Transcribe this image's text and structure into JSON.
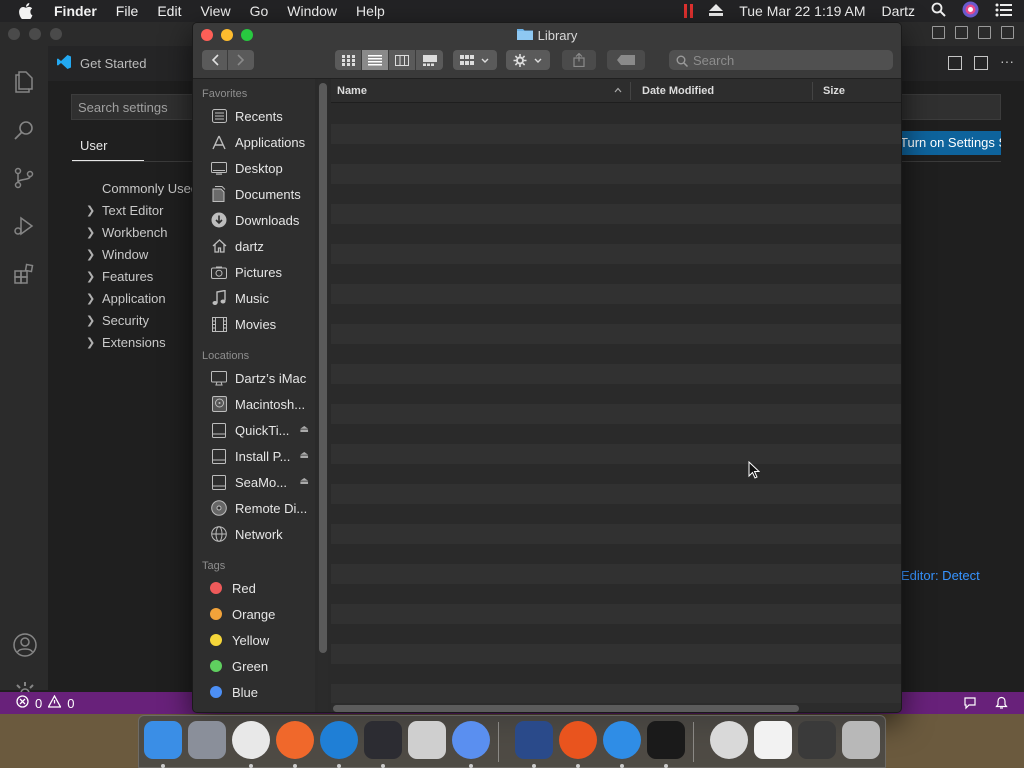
{
  "menubar": {
    "apple_icon": "apple-logo",
    "app_name": "Finder",
    "menus": [
      "File",
      "Edit",
      "View",
      "Go",
      "Window",
      "Help"
    ],
    "clock": "Tue Mar 22  1:19 AM",
    "user": "Dartz"
  },
  "vscode": {
    "tab_title": "Get Started",
    "search_placeholder": "Search settings",
    "user_tab": "User",
    "tree": [
      "Commonly Used",
      "Text Editor",
      "Workbench",
      "Window",
      "Features",
      "Application",
      "Security",
      "Extensions"
    ],
    "sync_button": "Turn on Settings Sync",
    "detect_link": "Editor: Detect",
    "status": {
      "errors": "0",
      "warnings": "0"
    },
    "statusbar_color": "#68217a",
    "accent": "#0e639c"
  },
  "finder": {
    "window_title": "Library",
    "search_placeholder": "Search",
    "view_modes": [
      "icon-view",
      "list-view",
      "column-view",
      "gallery-view"
    ],
    "active_view": "list-view",
    "sidebar": {
      "favorites_label": "Favorites",
      "favorites": [
        {
          "label": "Recents",
          "icon": "recents-icon"
        },
        {
          "label": "Applications",
          "icon": "applications-icon"
        },
        {
          "label": "Desktop",
          "icon": "desktop-icon"
        },
        {
          "label": "Documents",
          "icon": "documents-icon"
        },
        {
          "label": "Downloads",
          "icon": "downloads-icon"
        },
        {
          "label": "dartz",
          "icon": "home-icon"
        },
        {
          "label": "Pictures",
          "icon": "pictures-icon"
        },
        {
          "label": "Music",
          "icon": "music-icon"
        },
        {
          "label": "Movies",
          "icon": "movies-icon"
        }
      ],
      "locations_label": "Locations",
      "locations": [
        {
          "label": "Dartz’s iMac",
          "icon": "imac-icon",
          "eject": false
        },
        {
          "label": "Macintosh...",
          "icon": "hard-disk-icon",
          "eject": false
        },
        {
          "label": "QuickTi...",
          "icon": "disk-image-icon",
          "eject": true
        },
        {
          "label": "Install P...",
          "icon": "disk-image-icon",
          "eject": true
        },
        {
          "label": "SeaMo...",
          "icon": "disk-image-icon",
          "eject": true
        },
        {
          "label": "Remote Di...",
          "icon": "optical-disc-icon",
          "eject": false
        },
        {
          "label": "Network",
          "icon": "network-icon",
          "eject": false
        }
      ],
      "tags_label": "Tags",
      "tags": [
        {
          "label": "Red",
          "color": "#ee5a5a"
        },
        {
          "label": "Orange",
          "color": "#f2a33a"
        },
        {
          "label": "Yellow",
          "color": "#f5d63a"
        },
        {
          "label": "Green",
          "color": "#5fcf5f"
        },
        {
          "label": "Blue",
          "color": "#4c8ff5"
        }
      ]
    },
    "columns": [
      "Name",
      "Date Modified",
      "Size"
    ],
    "sort_column": "Name",
    "row_count": 30
  },
  "dock": {
    "apps": [
      {
        "name": "finder",
        "color": "#3a8ee6",
        "running": true
      },
      {
        "name": "launchpad",
        "color": "#8a8f9a",
        "running": false
      },
      {
        "name": "chrome",
        "color": "#e8e8e8",
        "running": true
      },
      {
        "name": "firefox",
        "color": "#f0682b",
        "running": true
      },
      {
        "name": "edge",
        "color": "#1f7fd6",
        "running": true
      },
      {
        "name": "vscode",
        "color": "#2c2c32",
        "running": true
      },
      {
        "name": "disk-utility-pro",
        "color": "#cfcfcf",
        "running": false
      },
      {
        "name": "chromium",
        "color": "#5a8ff0",
        "running": true
      },
      {
        "name": "system-info",
        "color": "#2a4a8a",
        "running": true
      },
      {
        "name": "ubuntu",
        "color": "#e9541e",
        "running": true
      },
      {
        "name": "safari",
        "color": "#2f8de6",
        "running": true
      },
      {
        "name": "terminal",
        "color": "#1a1a1a",
        "running": true
      },
      {
        "name": "no-entry",
        "color": "#d9d9d9",
        "running": false
      },
      {
        "name": "preview",
        "color": "#f2f2f2",
        "running": false
      },
      {
        "name": "activity-stack",
        "color": "#3a3a3a",
        "running": false
      },
      {
        "name": "trash",
        "color": "#b8b8b8",
        "running": false
      }
    ]
  }
}
